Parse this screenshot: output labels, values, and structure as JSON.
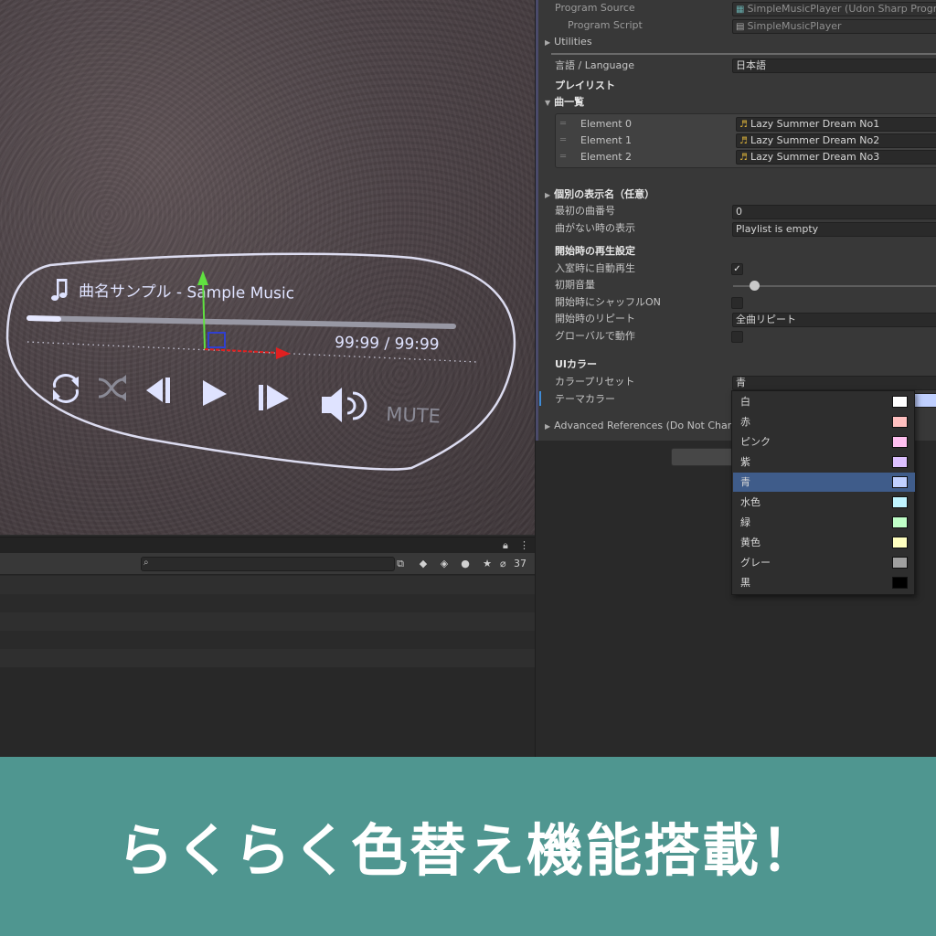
{
  "player": {
    "track_title": "曲名サンプル - Sample Music",
    "time_text": "99:99 / 99:99",
    "mute_label": "MUTE"
  },
  "hierarchy": {
    "search_placeholder": "",
    "hidden_count": "37"
  },
  "inspector": {
    "program_source_label": "Program Source",
    "program_source_value": "SimpleMusicPlayer (Udon Sharp Program",
    "program_script_label": "Program Script",
    "program_script_value": "SimpleMusicPlayer",
    "utilities_label": "Utilities",
    "language_label": "言語 / Language",
    "language_value": "日本語",
    "playlist_header": "プレイリスト",
    "tracklist_label": "曲一覧",
    "elements": [
      {
        "label": "Element 0",
        "value": "Lazy Summer Dream No1"
      },
      {
        "label": "Element 1",
        "value": "Lazy Summer Dream No2"
      },
      {
        "label": "Element 2",
        "value": "Lazy Summer Dream No3"
      }
    ],
    "display_names_label": "個別の表示名（任意）",
    "first_track_label": "最初の曲番号",
    "first_track_value": "0",
    "empty_label": "曲がない時の表示",
    "empty_value": "Playlist is empty",
    "startup_header": "開始時の再生設定",
    "autoplay_label": "入室時に自動再生",
    "autoplay_check": "✓",
    "volume_label": "初期音量",
    "volume_level": 0.1,
    "shuffle_label": "開始時にシャッフルON",
    "repeat_label": "開始時のリピート",
    "repeat_value": "全曲リピート",
    "global_label": "グローバルで動作",
    "ui_color_header": "UIカラー",
    "preset_label": "カラープリセット",
    "preset_value": "青",
    "theme_label": "テーマカラー",
    "advanced_label": "Advanced References (Do Not Chang"
  },
  "dropdown": {
    "options": [
      {
        "label": "白",
        "color": "#ffffff"
      },
      {
        "label": "赤",
        "color": "#ffc0c0"
      },
      {
        "label": "ピンク",
        "color": "#ffc0f0"
      },
      {
        "label": "紫",
        "color": "#dcc0ff"
      },
      {
        "label": "青",
        "color": "#c0d0ff"
      },
      {
        "label": "水色",
        "color": "#c0f4ff"
      },
      {
        "label": "緑",
        "color": "#c0ffc8"
      },
      {
        "label": "黄色",
        "color": "#ffffc0"
      },
      {
        "label": "グレー",
        "color": "#a0a0a0"
      },
      {
        "label": "黒",
        "color": "#000000"
      }
    ],
    "selected_index": 4
  },
  "banner": {
    "text": "らくらく色替え機能搭載！"
  },
  "colors": {
    "player_accent": "#c8d0ff",
    "banner_bg": "#4f9690",
    "selection": "#3f5c8a"
  }
}
